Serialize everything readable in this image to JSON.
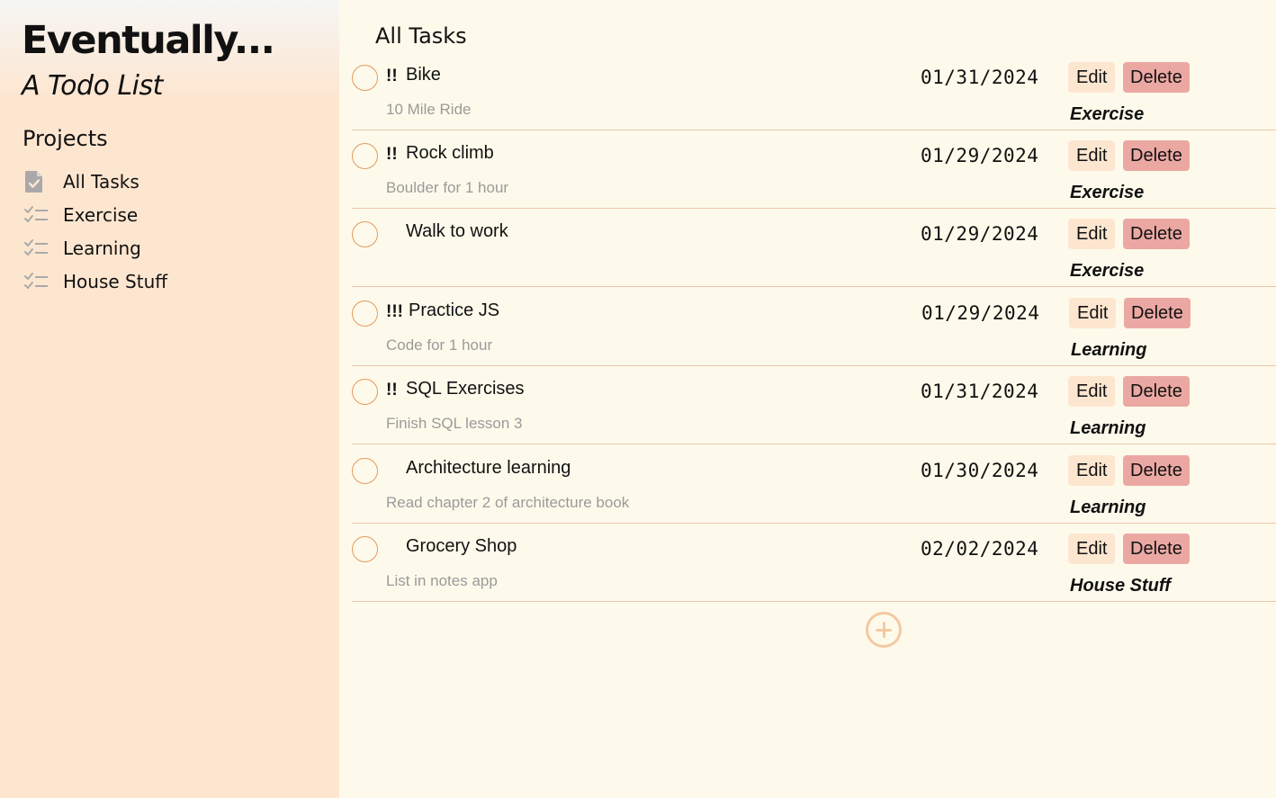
{
  "sidebar": {
    "app_title": "Eventually...",
    "app_subtitle": "A Todo List",
    "projects_heading": "Projects",
    "items": [
      {
        "label": "All Tasks",
        "icon": "document-check-icon"
      },
      {
        "label": "Exercise",
        "icon": "checklist-icon"
      },
      {
        "label": "Learning",
        "icon": "checklist-icon"
      },
      {
        "label": "House Stuff",
        "icon": "checklist-icon"
      }
    ]
  },
  "main": {
    "title": "All Tasks",
    "edit_label": "Edit",
    "delete_label": "Delete",
    "add_icon": "plus-circle-icon",
    "tasks": [
      {
        "priority": "!!",
        "name": "Bike",
        "description": "10 Mile Ride",
        "date": "01/31/2024",
        "project": "Exercise"
      },
      {
        "priority": "!!",
        "name": "Rock climb",
        "description": "Boulder for 1 hour",
        "date": "01/29/2024",
        "project": "Exercise"
      },
      {
        "priority": "",
        "name": "Walk to work",
        "description": "",
        "date": "01/29/2024",
        "project": "Exercise"
      },
      {
        "priority": "!!!",
        "name": "Practice JS",
        "description": "Code for 1 hour",
        "date": "01/29/2024",
        "project": "Learning"
      },
      {
        "priority": "!!",
        "name": "SQL Exercises",
        "description": "Finish SQL lesson 3",
        "date": "01/31/2024",
        "project": "Learning"
      },
      {
        "priority": "",
        "name": "Architecture learning",
        "description": "Read chapter 2 of architecture book",
        "date": "01/30/2024",
        "project": "Learning"
      },
      {
        "priority": "",
        "name": "Grocery Shop",
        "description": "List in notes app",
        "date": "02/02/2024",
        "project": "House Stuff"
      }
    ]
  },
  "colors": {
    "sidebar_bg": "#fde6d0",
    "main_bg": "#fefaeb",
    "check_ring": "#e59a5c",
    "edit_bg": "#fde6d0",
    "delete_bg": "#eba8a3",
    "divider": "#ecc6a8"
  }
}
